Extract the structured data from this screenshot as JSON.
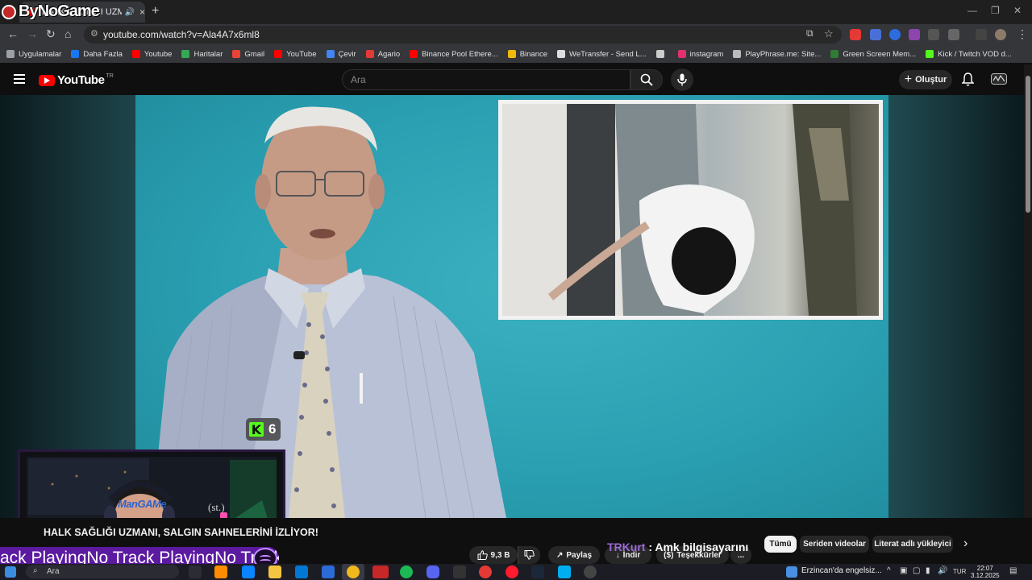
{
  "browser": {
    "tab": {
      "title": "HALK SAĞLIĞI UZMANI, SA",
      "audio_icon": "speaker-icon",
      "close": "×"
    },
    "new_tab": "+",
    "overlay_watermark": "ByNoGame",
    "url": "youtube.com/watch?v=Ala4A7x6ml8",
    "bookmarks": [
      {
        "label": "Uygulamalar",
        "icon": "apps-grid-icon",
        "color": "#9aa0a6"
      },
      {
        "label": "Daha Fazla",
        "icon": "facebook-icon",
        "color": "#1877f2"
      },
      {
        "label": "Youtube",
        "icon": "youtube-icon",
        "color": "#ff0000"
      },
      {
        "label": "Haritalar",
        "icon": "maps-icon",
        "color": "#34a853"
      },
      {
        "label": "Gmail",
        "icon": "gmail-icon",
        "color": "#ea4335"
      },
      {
        "label": "YouTube",
        "icon": "youtube-icon",
        "color": "#ff0000"
      },
      {
        "label": "Çevir",
        "icon": "translate-icon",
        "color": "#4285f4"
      },
      {
        "label": "Agario",
        "icon": "agario-icon",
        "color": "#e53935"
      },
      {
        "label": "Binance Pool Ethere...",
        "icon": "youtube-icon",
        "color": "#ff0000"
      },
      {
        "label": "Binance",
        "icon": "binance-icon",
        "color": "#f0b90b"
      },
      {
        "label": "WeTransfer - Send L...",
        "icon": "wetransfer-icon",
        "color": "#dddddd"
      },
      {
        "label": "",
        "icon": "document-icon",
        "color": "#cccccc"
      },
      {
        "label": "instagram",
        "icon": "instagram-icon",
        "color": "#e1306c"
      },
      {
        "label": "PlayPhrase.me: Site...",
        "icon": "playphrase-icon",
        "color": "#bbbbbb"
      },
      {
        "label": "Green Screen Mem...",
        "icon": "green-screen-icon",
        "color": "#2e7d32"
      },
      {
        "label": "Kick / Twitch VOD d...",
        "icon": "kick-icon",
        "color": "#53fc18"
      }
    ]
  },
  "youtube": {
    "logo_text": "YouTube",
    "country_code": "TR",
    "search_placeholder": "Ara",
    "create_label": "Oluştur",
    "video": {
      "kick_badge": "6",
      "cam_label": "ManGAMe",
      "cam_suffix": "(st.)"
    },
    "title": "HALK SAĞLIĞI UZMANI, SALGIN SAHNELERİNİ İZLİYOR!",
    "likes": "9,3 B",
    "share_label": "Paylaş",
    "download_label": "İndir",
    "thanks_label": "Teşekkürler",
    "more": "...",
    "chat": {
      "user": "TRKurt",
      "sep": " : ",
      "message": "Amk bilgisayarını"
    },
    "chips": [
      "Tümü",
      "Seriden videolar",
      "Literat adlı yükleyici"
    ]
  },
  "overlay": {
    "now_playing": "ack PlayingNo Track PlayingNo Track PlayingN"
  },
  "taskbar": {
    "search": "Ara",
    "weather": "Erzincan'da engelsiz...",
    "lang": "TUR",
    "time": "22:07",
    "date": "3.12.2025"
  }
}
